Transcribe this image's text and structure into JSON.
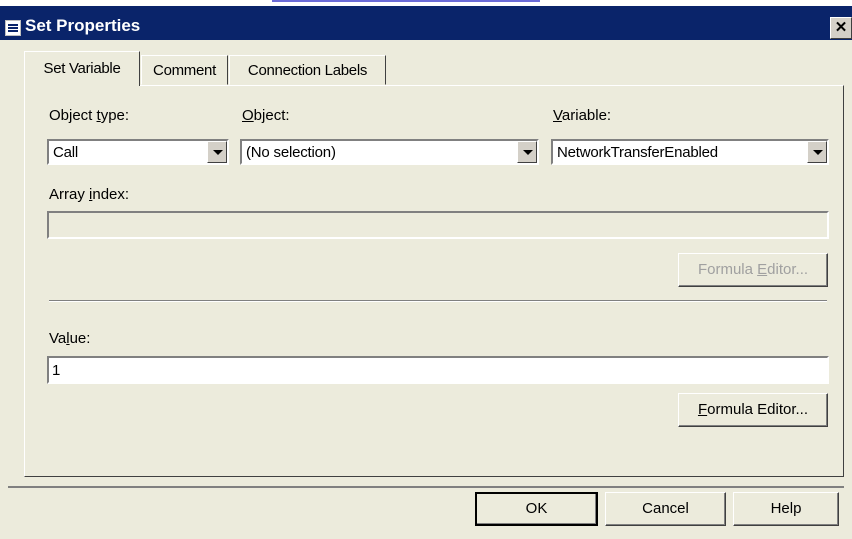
{
  "window": {
    "title": "Set Properties",
    "close_icon": "close-icon",
    "app_icon": "system-menu-icon"
  },
  "tabs": [
    {
      "label": "Set Variable",
      "active": true
    },
    {
      "label": "Comment",
      "active": false
    },
    {
      "label": "Connection Labels",
      "active": false
    }
  ],
  "form": {
    "object_type": {
      "label_pre": "Object ",
      "label_key": "t",
      "label_post": "ype:",
      "value": "Call"
    },
    "object": {
      "label_pre": "",
      "label_key": "O",
      "label_post": "bject:",
      "value": "(No selection)"
    },
    "variable": {
      "label_pre": "",
      "label_key": "V",
      "label_post": "ariable:",
      "value": "NetworkTransferEnabled"
    },
    "array_index": {
      "label_pre": "Array ",
      "label_key": "i",
      "label_post": "ndex:",
      "value": ""
    },
    "formula_editor_1": {
      "pre": "Formula ",
      "key": "E",
      "post": "ditor..."
    },
    "value": {
      "label_pre": "Va",
      "label_key": "l",
      "label_post": "ue:",
      "value": "1"
    },
    "formula_editor_2": {
      "pre": "",
      "key": "F",
      "post": "ormula Editor..."
    }
  },
  "footer": {
    "ok_label": "OK",
    "cancel_label": "Cancel",
    "help_label": "Help"
  },
  "colors": {
    "titlebar": "#0a246a",
    "dialog_bg": "#ecebdc"
  }
}
